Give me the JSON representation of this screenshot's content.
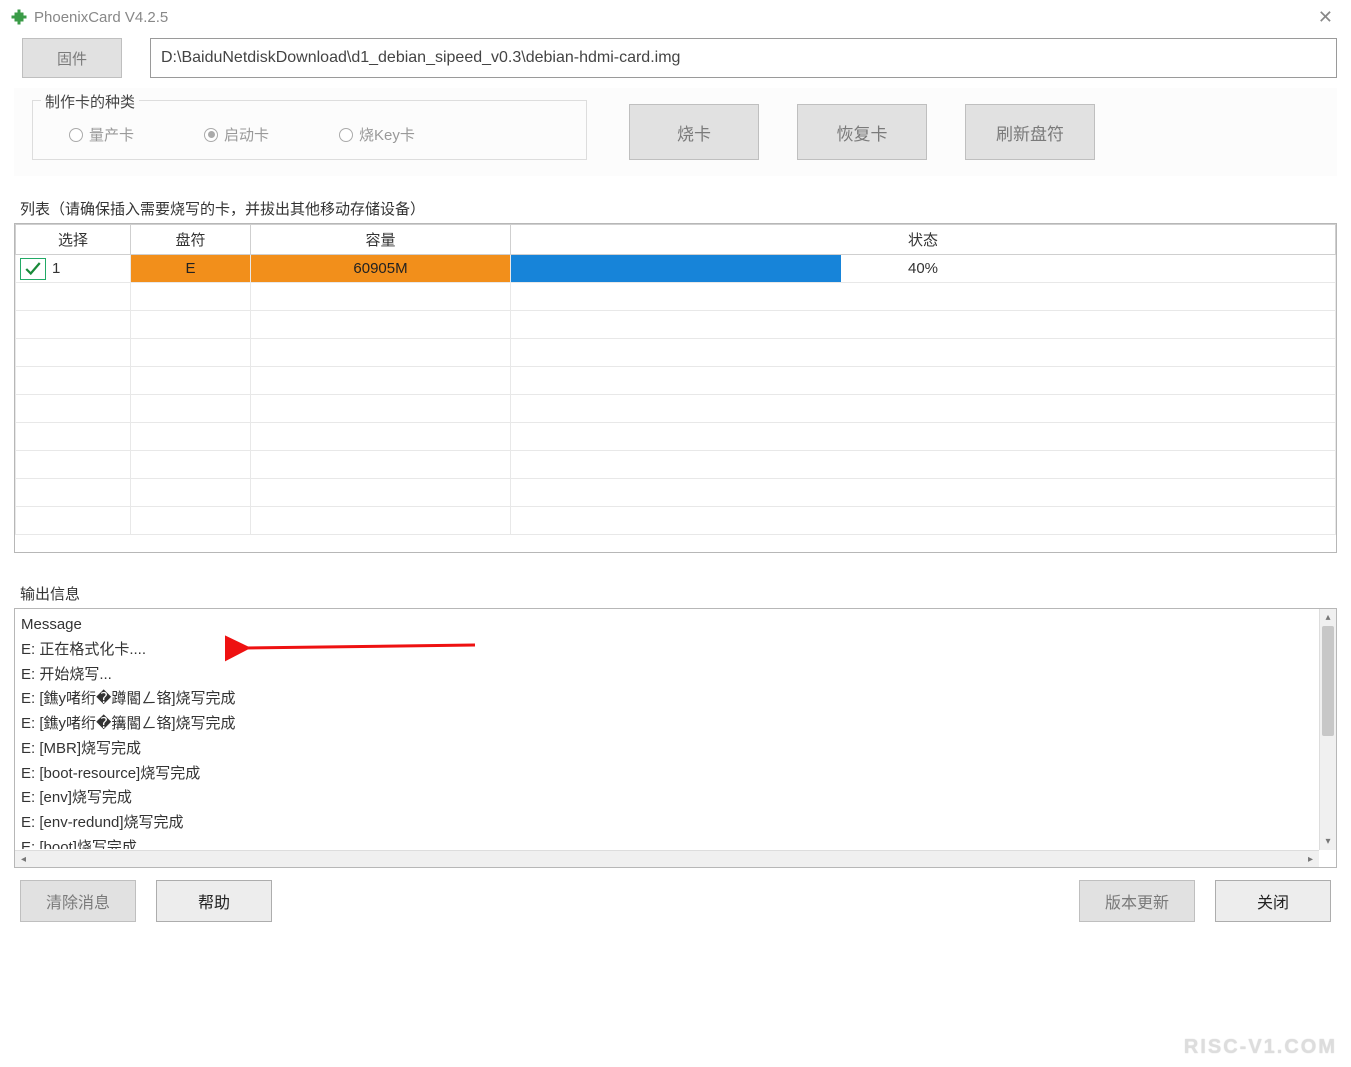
{
  "title": "PhoenixCard V4.2.5",
  "firmware": {
    "button_label": "固件",
    "path": "D:\\BaiduNetdiskDownload\\d1_debian_sipeed_v0.3\\debian-hdmi-card.img"
  },
  "card_type": {
    "legend": "制作卡的种类",
    "options": {
      "mass": "量产卡",
      "boot": "启动卡",
      "key": "烧Key卡"
    },
    "selected": "boot"
  },
  "actions": {
    "burn": "烧卡",
    "restore": "恢复卡",
    "refresh": "刷新盘符"
  },
  "list": {
    "legend": "列表（请确保插入需要烧写的卡，并拔出其他移动存储设备）",
    "headers": {
      "select": "选择",
      "drive": "盘符",
      "capacity": "容量",
      "status": "状态"
    },
    "rows": [
      {
        "index": "1",
        "drive": "E",
        "capacity": "60905M",
        "progress_percent": 40,
        "status_text": "40%"
      }
    ]
  },
  "output": {
    "legend": "输出信息",
    "header": "Message",
    "lines": [
      "E: 正在格式化卡....",
      "E: 开始烧写...",
      "E: [鐎у啫绗�蹲閽ㄥ铬]烧写完成",
      "E: [鐎у啫绗�簼閽ㄥ铬]烧写完成",
      "E: [MBR]烧写完成",
      "E: [boot-resource]烧写完成",
      "E: [env]烧写完成",
      "E: [env-redund]烧写完成",
      "E: [boot]烧写完成"
    ]
  },
  "footer": {
    "clear": "清除消息",
    "help": "帮助",
    "update": "版本更新",
    "close": "关闭"
  },
  "watermark": "RISC-V1.COM"
}
